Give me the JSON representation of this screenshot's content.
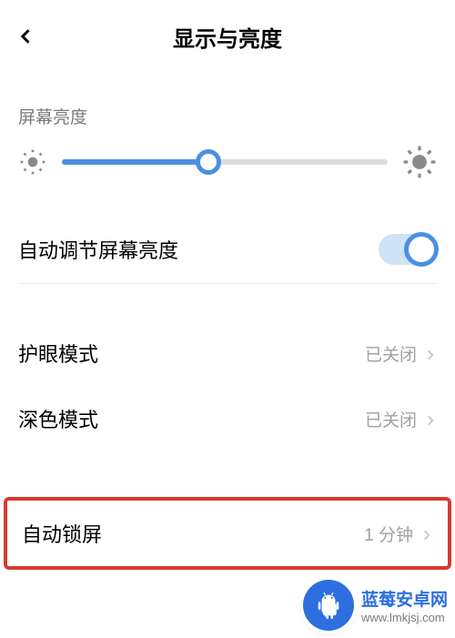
{
  "header": {
    "title": "显示与亮度"
  },
  "brightness": {
    "section_label": "屏幕亮度",
    "slider_percent": 45
  },
  "auto_brightness": {
    "label": "自动调节屏幕亮度",
    "enabled": true
  },
  "rows": {
    "eye_care": {
      "label": "护眼模式",
      "value": "已关闭"
    },
    "dark_mode": {
      "label": "深色模式",
      "value": "已关闭"
    },
    "auto_lock": {
      "label": "自动锁屏",
      "value": "1 分钟"
    }
  },
  "icons": {
    "back": "back-icon",
    "sun_small": "sun-small-icon",
    "sun_large": "sun-large-icon",
    "chevron": "chevron-right-icon",
    "android": "android-icon"
  },
  "watermark": {
    "title": "蓝莓安卓网",
    "url": "www.lmkjsj.com"
  },
  "colors": {
    "accent": "#4a90e2",
    "highlight_border": "#d83a2f"
  }
}
